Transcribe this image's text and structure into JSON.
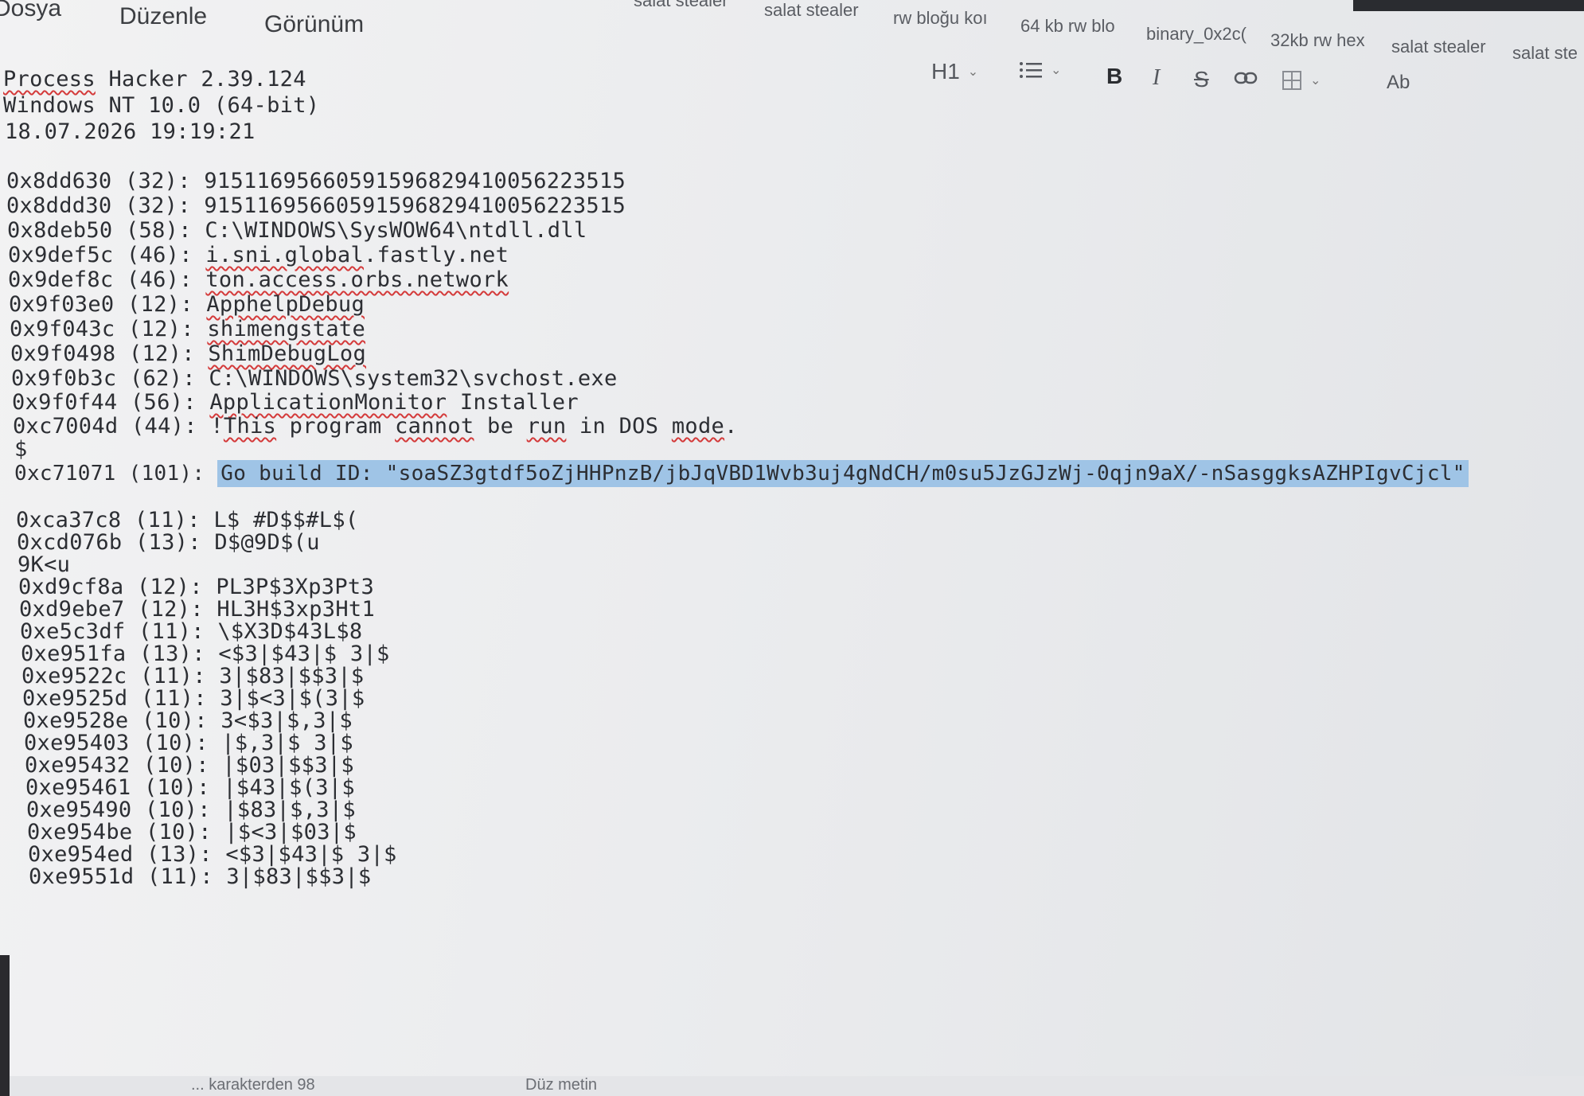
{
  "menu": [
    "Dosya",
    "Düzenle",
    "Görünüm"
  ],
  "tabs": [
    "salat stealer",
    "salat stealer",
    "rw bloğu koı",
    "64 kb rw blo",
    "binary_0x2c(",
    "32kb rw hex",
    "salat stealer",
    "salat ste"
  ],
  "toolbar": {
    "heading": "H1",
    "bold": "B",
    "italic": "I",
    "strike": "S",
    "spell": "Ab"
  },
  "document": {
    "header": [
      "Process Hacker 2.39.124",
      "Windows NT 10.0 (64-bit)",
      "18.07.2026 19:19:21"
    ],
    "lines": [
      "0x8dd630 (32): 91511695660591596829410056223515",
      "0x8ddd30 (32): 91511695660591596829410056223515",
      "0x8deb50 (58): C:\\WINDOWS\\SysWOW64\\ntdll.dll",
      "0x9def5c (46): i.sni.global.fastly.net",
      "0x9def8c (46): ton.access.orbs.network",
      "0x9f03e0 (12): ApphelpDebug",
      "0x9f043c (12): shimengstate",
      "0x9f0498 (12): ShimDebugLog",
      "0x9f0b3c (62): C:\\WINDOWS\\system32\\svchost.exe",
      "0x9f0f44 (56): ApplicationMonitor Installer",
      "0xc7004d (44): !This program cannot be run in DOS mode.",
      "$"
    ],
    "build_prefix": "0xc71071 (101): ",
    "build_id": "Go build ID: \"soaSZ3gtdf5oZjHHPnzB/jbJqVBD1Wvb3uj4gNdCH/m0su5JzGJzWj-0qjn9aX/-nSasggksAZHPIgvCjcl\"",
    "lines2": [
      "0xca37c8 (11): L$ #D$$#L$(",
      "0xcd076b (13): D$@9D$(u",
      "9K<u",
      "0xd9cf8a (12): PL3P$3Xp3Pt3",
      "0xd9ebe7 (12): HL3H$3xp3Ht1",
      "0xe5c3df (11): \\$X3D$43L$8",
      "0xe951fa (13): <$3|$43|$ 3|$",
      "0xe9522c (11): 3|$83|$$3|$",
      "0xe9525d (11): 3|$<3|$(3|$",
      "0xe9528e (10): 3<$3|$,3|$",
      "0xe95403 (10): |$,3|$ 3|$",
      "0xe95432 (10): |$03|$$3|$",
      "0xe95461 (10): |$43|$(3|$",
      "0xe95490 (10): |$83|$,3|$",
      "0xe954be (10): |$<3|$03|$",
      "0xe954ed (13): <$3|$43|$ 3|$",
      "0xe9551d (11): 3|$83|$$3|$"
    ]
  },
  "status": {
    "chars": "... karakterden 98",
    "mode": "Düz metin"
  }
}
